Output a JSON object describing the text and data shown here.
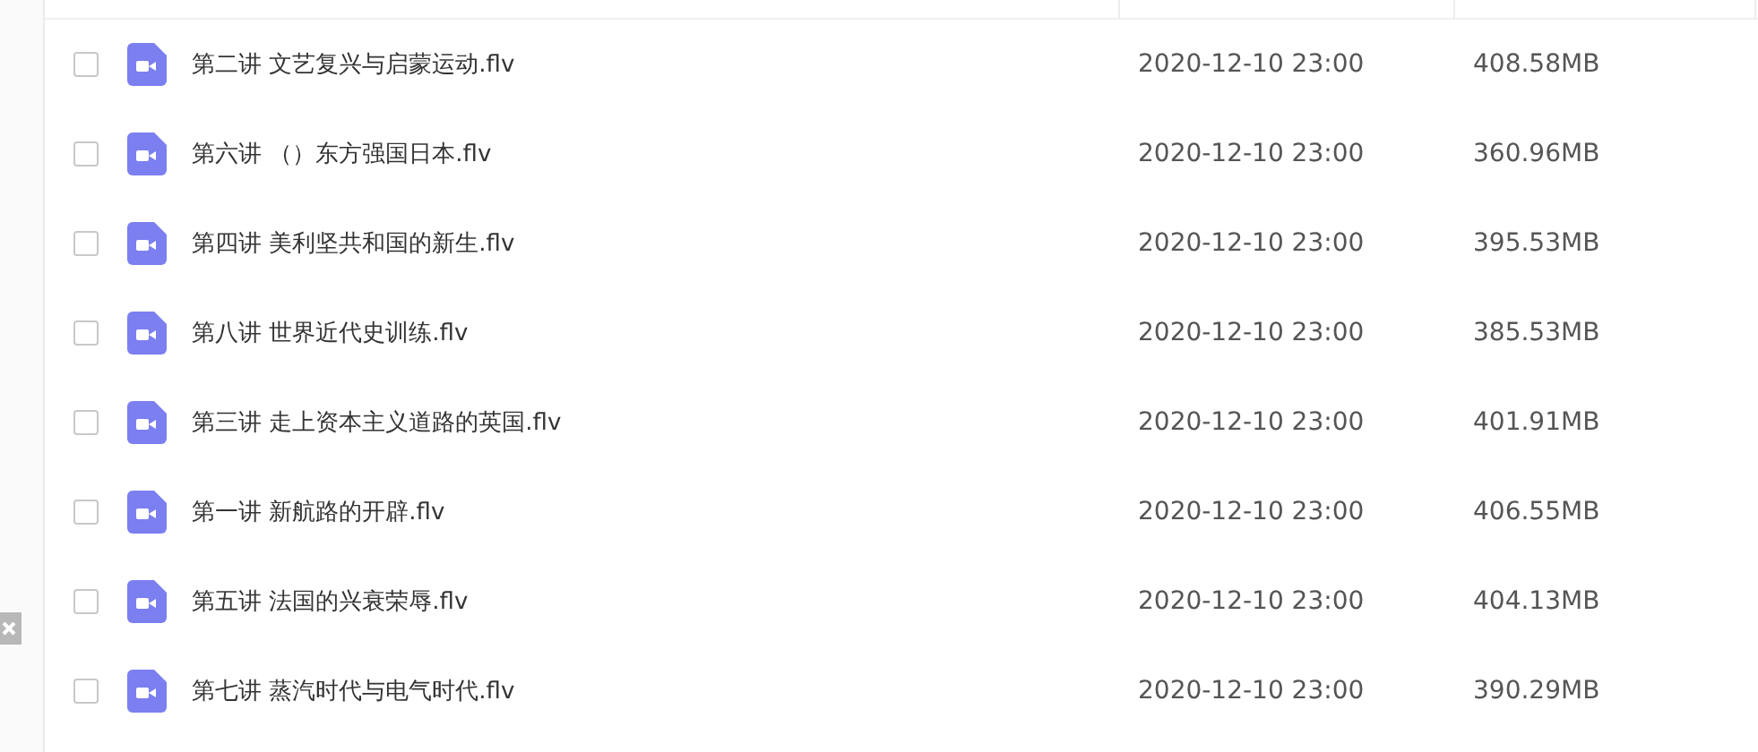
{
  "files": [
    {
      "name": "第二讲 文艺复兴与启蒙运动.flv",
      "modified": "2020-12-10 23:00",
      "size": "408.58MB",
      "checked": false
    },
    {
      "name": "第六讲 （）东方强国日本.flv",
      "modified": "2020-12-10 23:00",
      "size": "360.96MB",
      "checked": false
    },
    {
      "name": "第四讲 美利坚共和国的新生.flv",
      "modified": "2020-12-10 23:00",
      "size": "395.53MB",
      "checked": false
    },
    {
      "name": "第八讲 世界近代史训练.flv",
      "modified": "2020-12-10 23:00",
      "size": "385.53MB",
      "checked": false
    },
    {
      "name": "第三讲 走上资本主义道路的英国.flv",
      "modified": "2020-12-10 23:00",
      "size": "401.91MB",
      "checked": false
    },
    {
      "name": "第一讲 新航路的开辟.flv",
      "modified": "2020-12-10 23:00",
      "size": "406.55MB",
      "checked": false
    },
    {
      "name": "第五讲 法国的兴衰荣辱.flv",
      "modified": "2020-12-10 23:00",
      "size": "404.13MB",
      "checked": false
    },
    {
      "name": "第七讲 蒸汽时代与电气时代.flv",
      "modified": "2020-12-10 23:00",
      "size": "390.29MB",
      "checked": false
    }
  ]
}
